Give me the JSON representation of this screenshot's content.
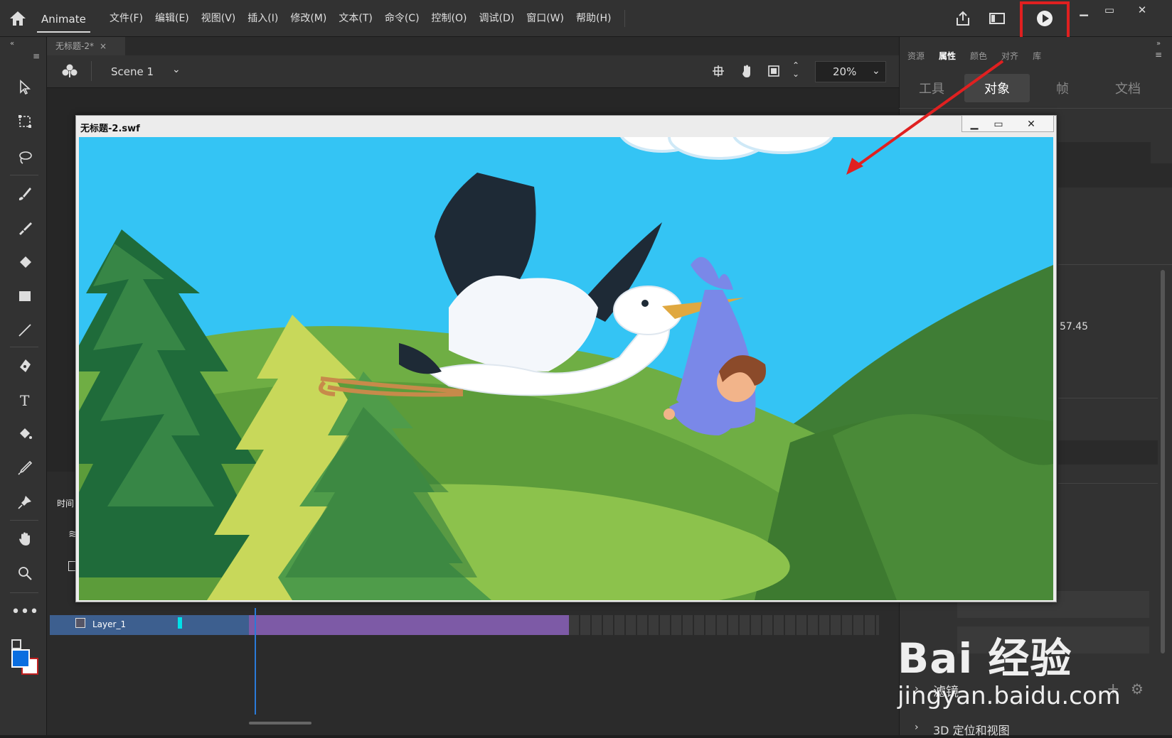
{
  "app": {
    "name": "Animate"
  },
  "menus": [
    "文件(F)",
    "编辑(E)",
    "视图(V)",
    "插入(I)",
    "修改(M)",
    "文本(T)",
    "命令(C)",
    "控制(O)",
    "调试(D)",
    "窗口(W)",
    "帮助(H)"
  ],
  "toolbar_icons": [
    "share-icon",
    "layout-icon",
    "test-movie-play-icon"
  ],
  "document": {
    "tab": "无标题-2*"
  },
  "scene": {
    "name": "Scene 1",
    "zoom": "20%"
  },
  "right_panel": {
    "tabs": [
      "资源",
      "属性",
      "颜色",
      "对齐",
      "库"
    ],
    "active_tab": "属性",
    "subtabs": [
      "工具",
      "对象",
      "帧",
      "文档"
    ],
    "active_subtab": "对象",
    "coord_value": "57.45",
    "filters_label": "滤镜",
    "section_3d": "3D 定位和视图"
  },
  "timeline": {
    "title": "时间",
    "layer": "Layer_1"
  },
  "swf_window": {
    "title": "无标题-2.swf"
  },
  "watermark": {
    "brand": "Bai 经验",
    "url": "jingyan.baidu.com"
  },
  "colors": {
    "highlight": "#e02020",
    "sky": "#34c4f4",
    "frames": "#7d5aa6"
  }
}
